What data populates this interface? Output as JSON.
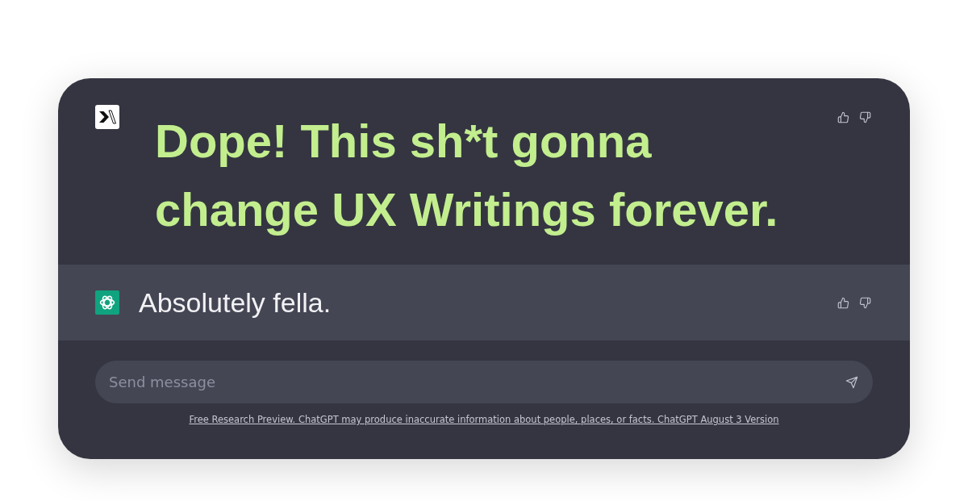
{
  "messages": [
    {
      "kind": "user",
      "text": "Dope! This sh*t gonna change UX Writings forever."
    },
    {
      "kind": "assistant",
      "text": "Absolutely fella."
    }
  ],
  "composer": {
    "placeholder": "Send message"
  },
  "footer": {
    "text": "Free Research Preview. ChatGPT may produce inaccurate information about people, places, or facts. ChatGPT August 3 Version"
  }
}
